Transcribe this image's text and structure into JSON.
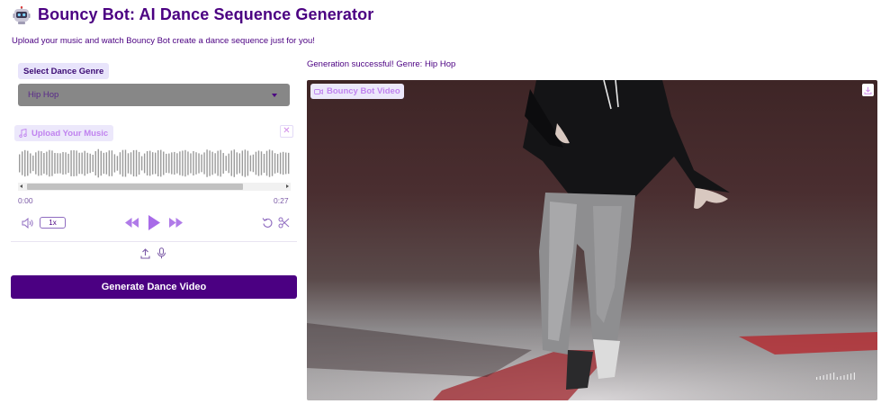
{
  "header": {
    "title": "Bouncy Bot: AI Dance Sequence Generator",
    "subtitle": "Upload your music and watch Bouncy Bot create a dance sequence just for you!",
    "logo_icon": "robot-icon"
  },
  "controls": {
    "genre_label": "Select Dance Genre",
    "genre_value": "Hip Hop",
    "upload_label": "Upload Your Music",
    "upload_icon": "music-note-icon"
  },
  "audio": {
    "time_start": "0:00",
    "time_end": "0:27",
    "speed": "1x",
    "playback_progress": 0
  },
  "actions": {
    "generate_label": "Generate Dance Video"
  },
  "output": {
    "status": "Generation successful! Genre: Hip Hop",
    "video_label": "Bouncy Bot Video",
    "video_icon": "video-camera-icon"
  },
  "colors": {
    "brand_purple": "#4b0082",
    "accent_pink": "#c083ef",
    "label_bg": "#ece8fb",
    "select_bg": "#878787"
  }
}
